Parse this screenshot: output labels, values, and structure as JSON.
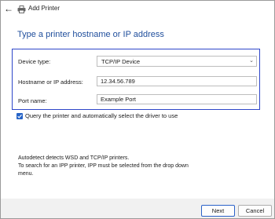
{
  "window": {
    "title": "Add Printer",
    "back_icon": "back-arrow-icon",
    "app_icon": "printer-icon"
  },
  "page": {
    "heading": "Type a printer hostname or IP address"
  },
  "form": {
    "device_type": {
      "label": "Device type:",
      "value": "TCP/IP Device"
    },
    "hostname": {
      "label": "Hostname or IP address:",
      "value": "12.34.56.789"
    },
    "port_name": {
      "label": "Port name:",
      "value": "Example Port"
    }
  },
  "query_checkbox": {
    "label": "Query the printer and automatically select the driver to use",
    "checked": true
  },
  "info": {
    "line1": "Autodetect detects WSD and TCP/IP printers.",
    "line2": "To search for an IPP printer, IPP must be selected from the drop down",
    "line3": "menu."
  },
  "buttons": {
    "next": "Next",
    "cancel": "Cancel"
  },
  "colors": {
    "heading": "#1f4e9c",
    "highlight_border": "#2e46c9",
    "checkbox": "#2764c7"
  }
}
